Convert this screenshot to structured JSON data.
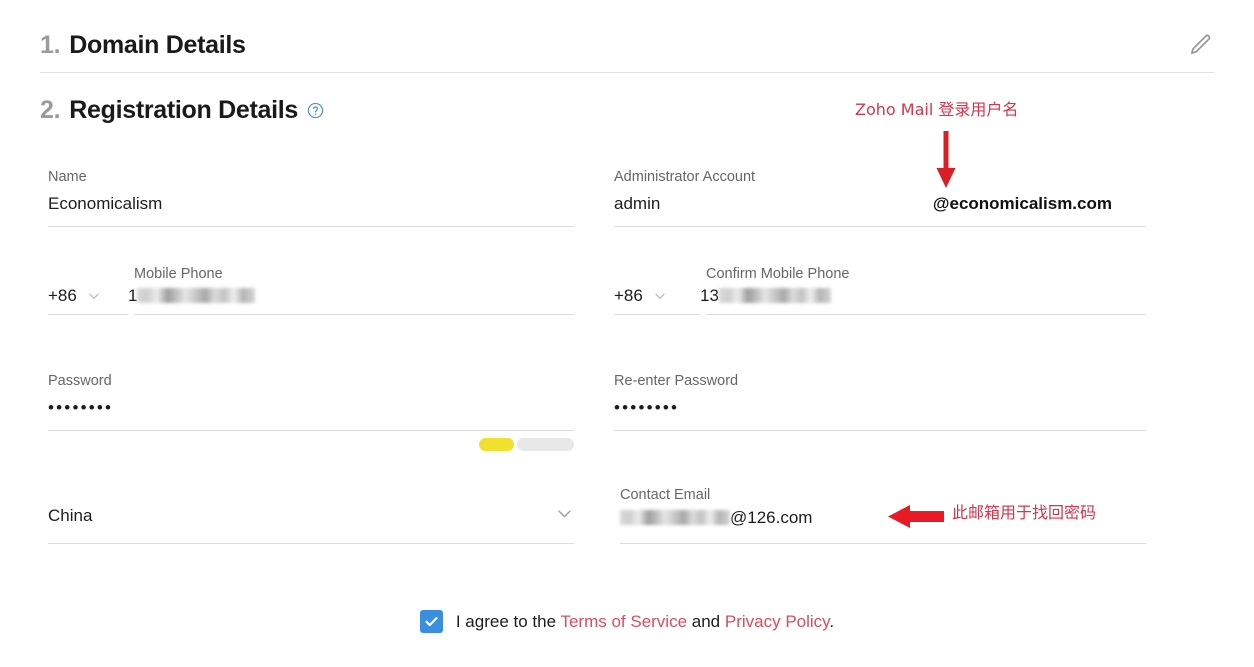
{
  "sections": {
    "domain_details": {
      "number": "1.",
      "title": "Domain Details",
      "edit_icon": "pencil-icon"
    },
    "registration_details": {
      "number": "2.",
      "title": "Registration Details",
      "help_icon": "help-circle-icon"
    }
  },
  "form": {
    "name": {
      "label": "Name",
      "value": "Economicalism"
    },
    "administrator_account": {
      "label": "Administrator Account",
      "value": "admin",
      "domain_suffix": "@economicalism.com"
    },
    "mobile_phone": {
      "label": "Mobile Phone",
      "country_code": "+86",
      "value": "1",
      "redacted": true
    },
    "confirm_mobile_phone": {
      "label": "Confirm Mobile Phone",
      "country_code": "+86",
      "value": "13",
      "redacted": true
    },
    "password": {
      "label": "Password",
      "value": "••••••••",
      "strength_filled_color": "#f2e02e",
      "strength_empty_color": "#e8e8e8"
    },
    "reenter_password": {
      "label": "Re-enter Password",
      "value": "••••••••"
    },
    "country": {
      "label": "",
      "value": "China",
      "chevron_icon": "chevron-down-icon"
    },
    "contact_email": {
      "label": "Contact Email",
      "value": "@126.com",
      "redacted": true
    }
  },
  "annotations": [
    {
      "id": "admin-account-note",
      "text": "Zoho Mail 登录用户名",
      "color": "#d8344a",
      "arrow": "arrow-down-icon"
    },
    {
      "id": "contact-email-note",
      "text": "此邮箱用于找回密码",
      "color": "#d8344a",
      "arrow": "arrow-left-icon"
    }
  ],
  "agreement": {
    "checked": true,
    "checkbox_color": "#3b8ede",
    "prefix": "I agree to the ",
    "terms_link": "Terms of Service",
    "conjunction": " and ",
    "privacy_link": "Privacy Policy",
    "suffix": ".",
    "link_color": "#e04a5a"
  }
}
